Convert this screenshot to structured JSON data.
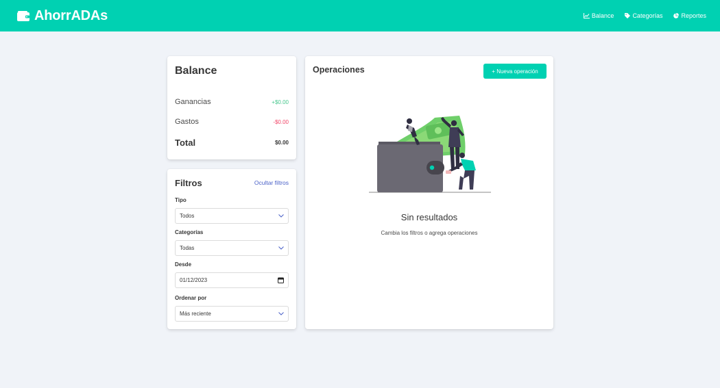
{
  "app": {
    "name": "AhorrADAs"
  },
  "nav": {
    "items": [
      {
        "label": "Balance",
        "icon": "chart-line-icon"
      },
      {
        "label": "Categorías",
        "icon": "tag-icon"
      },
      {
        "label": "Reportes",
        "icon": "pie-chart-icon"
      }
    ]
  },
  "balance": {
    "title": "Balance",
    "earnings_label": "Ganancias",
    "earnings_value": "+$0.00",
    "expenses_label": "Gastos",
    "expenses_value": "-$0.00",
    "total_label": "Total",
    "total_value": "$0.00"
  },
  "filters": {
    "title": "Filtros",
    "hide_label": "Ocultar filtros",
    "type_label": "Tipo",
    "type_value": "Todos",
    "category_label": "Categorías",
    "category_value": "Todas",
    "from_label": "Desde",
    "from_value": "01/12/2023",
    "order_label": "Ordenar por",
    "order_value": "Más reciente"
  },
  "operations": {
    "title": "Operaciones",
    "new_button_label": "+ Nueva operación",
    "empty_title": "Sin resultados",
    "empty_hint": "Cambia los filtros o agrega operaciones"
  },
  "colors": {
    "primary": "#00d1b2",
    "success": "#48c78e",
    "danger": "#f14668",
    "link": "#485fc7",
    "background": "#f0f3f8"
  }
}
